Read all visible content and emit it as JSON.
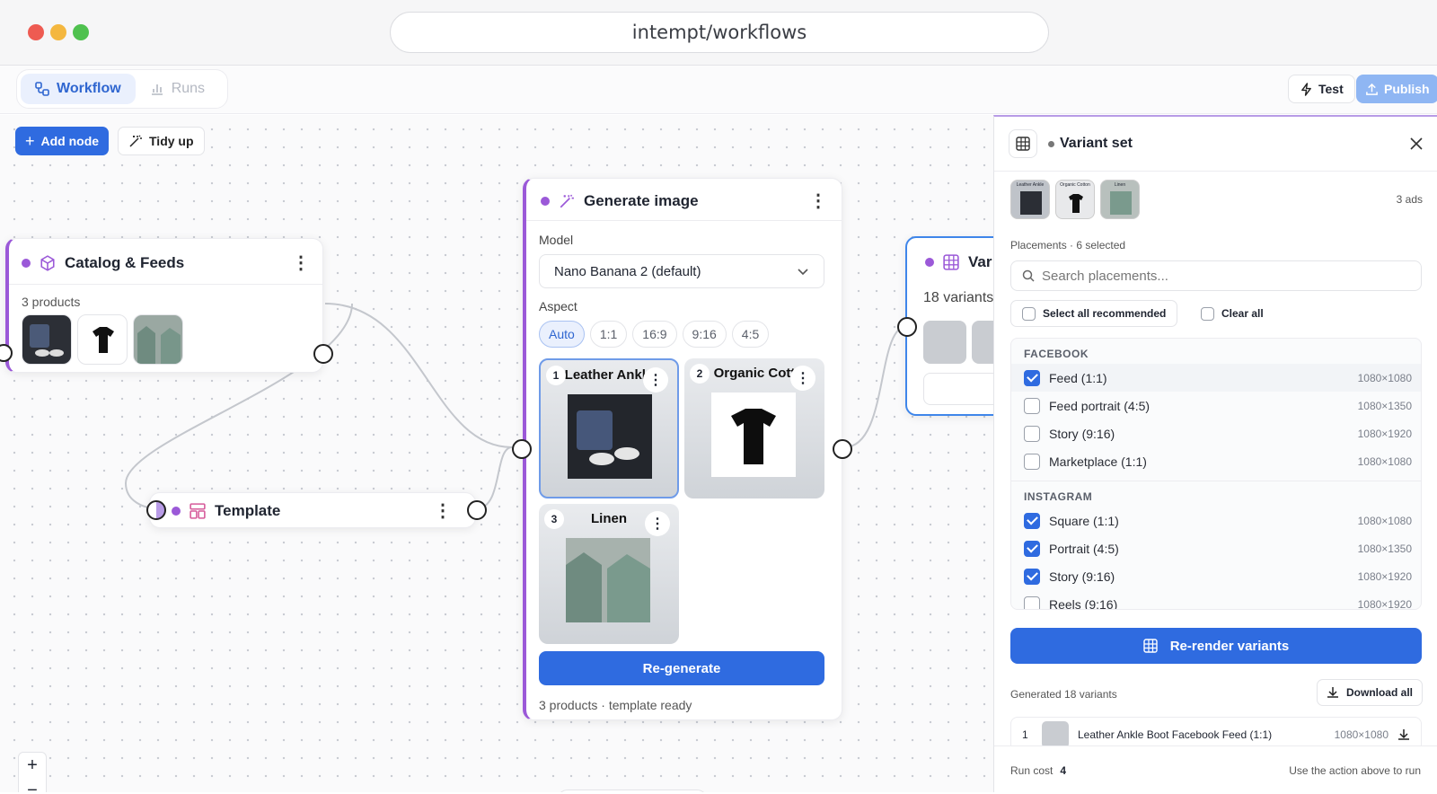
{
  "browser": {
    "url": "intempt/workflows"
  },
  "topbar": {
    "tabs": [
      {
        "label": "Workflow"
      },
      {
        "label": "Runs"
      }
    ],
    "test_label": "Test",
    "publish_label": "Publish"
  },
  "canvas": {
    "add_node_label": "Add node",
    "tidy_up_label": "Tidy up",
    "catalog_node": {
      "title": "Catalog & Feeds",
      "subtitle": "3 products"
    },
    "template_node": {
      "title": "Template"
    },
    "generate_node": {
      "title": "Generate image",
      "model_label": "Model",
      "model_value": "Nano Banana 2 (default)",
      "aspect_label": "Aspect",
      "aspects": [
        "Auto",
        "1:1",
        "16:9",
        "9:16",
        "4:5"
      ],
      "selected_aspect": "Auto",
      "images": [
        {
          "num": "1",
          "title": "Leather Ankle"
        },
        {
          "num": "2",
          "title": "Organic Cott"
        },
        {
          "num": "3",
          "title": "Linen"
        }
      ],
      "regenerate_label": "Re-generate",
      "footer": "3 products · template ready"
    },
    "variant_node": {
      "title": "Var",
      "subtitle": "18 variants"
    }
  },
  "panel": {
    "title": "Variant set",
    "ads_count": "3 ads",
    "thumbs": [
      "Leather Ankle",
      "Organic Cotton",
      "Linen"
    ],
    "placements_label": "Placements · 6 selected",
    "search_placeholder": "Search placements...",
    "select_all_label": "Select all recommended",
    "clear_all_label": "Clear all",
    "groups": [
      {
        "name": "FACEBOOK",
        "items": [
          {
            "label": "Feed (1:1)",
            "size": "1080×1080",
            "checked": true
          },
          {
            "label": "Feed portrait (4:5)",
            "size": "1080×1350",
            "checked": false
          },
          {
            "label": "Story (9:16)",
            "size": "1080×1920",
            "checked": false
          },
          {
            "label": "Marketplace (1:1)",
            "size": "1080×1080",
            "checked": false
          }
        ]
      },
      {
        "name": "INSTAGRAM",
        "items": [
          {
            "label": "Square (1:1)",
            "size": "1080×1080",
            "checked": true
          },
          {
            "label": "Portrait (4:5)",
            "size": "1080×1350",
            "checked": true
          },
          {
            "label": "Story (9:16)",
            "size": "1080×1920",
            "checked": true
          },
          {
            "label": "Reels (9:16)",
            "size": "1080×1920",
            "checked": false
          }
        ]
      }
    ],
    "rerender_label": "Re-render variants",
    "generated_label": "Generated 18 variants",
    "download_all_label": "Download all",
    "variant_row": {
      "num": "1",
      "name": "Leather Ankle Boot Facebook Feed (1:1)",
      "size": "1080×1080"
    },
    "run_cost_label": "Run cost",
    "run_cost_value": "4",
    "footer_hint": "Use the action above to run"
  },
  "colors": {
    "accent": "#2f6be0",
    "node_purple": "#9b59d8",
    "checkbox_on": "#2f6be0"
  }
}
